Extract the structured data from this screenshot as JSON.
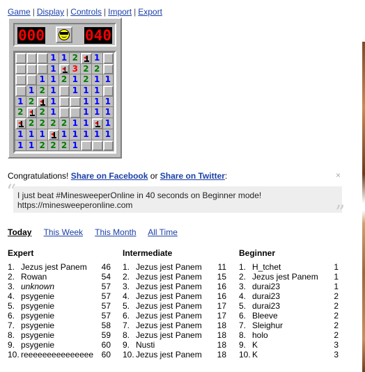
{
  "menu": [
    "Game",
    "Display",
    "Controls",
    "Import",
    "Export"
  ],
  "counters": {
    "mines": "000",
    "time": "040"
  },
  "face": "sunglasses-face-icon",
  "board": [
    [
      "c",
      "c",
      "c",
      "1",
      "1",
      "2",
      "F",
      "1",
      "c"
    ],
    [
      "c",
      "c",
      "c",
      "1",
      "F",
      "3",
      "2",
      "2",
      "c"
    ],
    [
      "c",
      "c",
      "1",
      "1",
      "2",
      "1",
      "2",
      "1",
      "1"
    ],
    [
      "c",
      "1",
      "2",
      "1",
      "c",
      "1",
      "1",
      "1",
      "c"
    ],
    [
      "1",
      "2",
      "F",
      "1",
      "c",
      "c",
      "1",
      "1",
      "1"
    ],
    [
      "2",
      "F",
      "2",
      "1",
      "c",
      "c",
      "1",
      "1",
      "1"
    ],
    [
      "F",
      "2",
      "2",
      "2",
      "2",
      "1",
      "1",
      "F",
      "1"
    ],
    [
      "1",
      "1",
      "1",
      "F",
      "1",
      "1",
      "1",
      "1",
      "1"
    ],
    [
      "1",
      "1",
      "2",
      "2",
      "2",
      "1",
      "c",
      "c",
      "c"
    ]
  ],
  "board_rows_note": "",
  "congrats": {
    "prefix": "Congratulations!",
    "facebook": "Share on Facebook",
    "or": "or",
    "twitter": "Share on Twitter",
    "suffix": ":",
    "close": "×",
    "message_line1": "I just beat #MinesweeperOnline in 40 seconds on Beginner mode!",
    "message_line2": "https://minesweeperonline.com"
  },
  "tabs": [
    "Today",
    "This Week",
    "This Month",
    "All Time"
  ],
  "leaderboards": {
    "expert": {
      "title": "Expert",
      "rows": [
        {
          "rank": "1.",
          "name": "Jezus jest Panem",
          "time": "46"
        },
        {
          "rank": "2.",
          "name": "Rowan",
          "time": "54"
        },
        {
          "rank": "3.",
          "name": "unknown",
          "time": "57",
          "italic": true
        },
        {
          "rank": "4.",
          "name": "psygenie",
          "time": "57"
        },
        {
          "rank": "5.",
          "name": "psygenie",
          "time": "57"
        },
        {
          "rank": "6.",
          "name": "psygenie",
          "time": "57"
        },
        {
          "rank": "7.",
          "name": "psygenie",
          "time": "58"
        },
        {
          "rank": "8.",
          "name": "psygenie",
          "time": "59"
        },
        {
          "rank": "9.",
          "name": "psygenie",
          "time": "60"
        },
        {
          "rank": "10.",
          "name": "reeeeeeeeeeeeeee",
          "time": "60"
        }
      ]
    },
    "intermediate": {
      "title": "Intermediate",
      "rows": [
        {
          "rank": "1.",
          "name": "Jezus jest Panem",
          "time": "11"
        },
        {
          "rank": "2.",
          "name": "Jezus jest Panem",
          "time": "15"
        },
        {
          "rank": "3.",
          "name": "Jezus jest Panem",
          "time": "16"
        },
        {
          "rank": "4.",
          "name": "Jezus jest Panem",
          "time": "16"
        },
        {
          "rank": "5.",
          "name": "Jezus jest Panem",
          "time": "17"
        },
        {
          "rank": "6.",
          "name": "Jezus jest Panem",
          "time": "17"
        },
        {
          "rank": "7.",
          "name": "Jezus jest Panem",
          "time": "18"
        },
        {
          "rank": "8.",
          "name": "Jezus jest Panem",
          "time": "18"
        },
        {
          "rank": "9.",
          "name": "Nusti",
          "time": "18"
        },
        {
          "rank": "10.",
          "name": "Jezus jest Panem",
          "time": "18"
        }
      ]
    },
    "beginner": {
      "title": "Beginner",
      "rows": [
        {
          "rank": "1.",
          "name": "H_tchet",
          "time": "1"
        },
        {
          "rank": "2.",
          "name": "Jezus jest Panem",
          "time": "1"
        },
        {
          "rank": "3.",
          "name": "durai23",
          "time": "1"
        },
        {
          "rank": "4.",
          "name": "durai23",
          "time": "2"
        },
        {
          "rank": "5.",
          "name": "durai23",
          "time": "2"
        },
        {
          "rank": "6.",
          "name": "Bleeve",
          "time": "2"
        },
        {
          "rank": "7.",
          "name": "Sleighur",
          "time": "2"
        },
        {
          "rank": "8.",
          "name": "holo",
          "time": "2"
        },
        {
          "rank": "9.",
          "name": "K",
          "time": "3"
        },
        {
          "rank": "10.",
          "name": "K",
          "time": "3"
        }
      ]
    }
  },
  "colors": {
    "link": "#1a3fa8",
    "lcd": "#f20000",
    "face": "#ffff00",
    "n1": "#0000ff",
    "n2": "#007b00",
    "n3": "#ff0000"
  }
}
